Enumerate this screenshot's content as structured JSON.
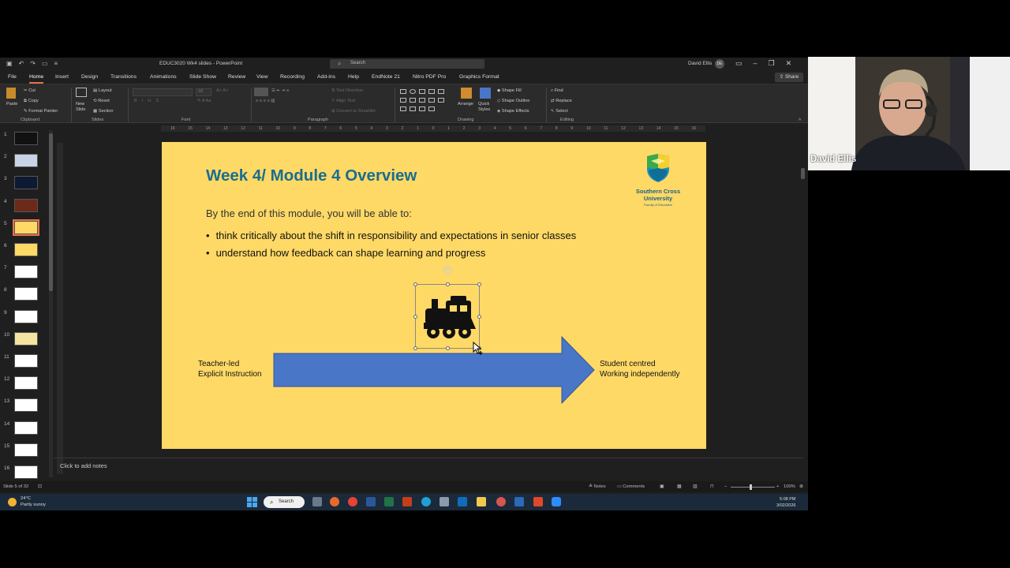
{
  "window": {
    "doc_title": "EDUC3020 Wk4 slides  -  PowerPoint",
    "search_placeholder": "Search",
    "user_name": "David Ellis",
    "user_initials": "DE"
  },
  "menu": {
    "tabs": [
      "File",
      "Home",
      "Insert",
      "Design",
      "Transitions",
      "Animations",
      "Slide Show",
      "Review",
      "View",
      "Recording",
      "Add-ins",
      "Help",
      "EndNote 21",
      "Nitro PDF Pro",
      "Graphics Format"
    ],
    "active_tab": "Home",
    "share_label": "Share"
  },
  "ribbon": {
    "clipboard": {
      "paste": "Paste",
      "cut": "Cut",
      "copy": "Copy",
      "format_painter": "Format Painter",
      "label": "Clipboard"
    },
    "slides": {
      "new_slide": "New Slide",
      "layout": "Layout",
      "reset": "Reset",
      "section": "Section",
      "label": "Slides"
    },
    "font": {
      "label": "Font",
      "font_size": "18"
    },
    "paragraph": {
      "text_direction": "Text Direction",
      "align_text": "Align Text",
      "convert_smartart": "Convert to SmartArt",
      "label": "Paragraph"
    },
    "drawing": {
      "arrange": "Arrange",
      "quick_styles": "Quick Styles",
      "shape_fill": "Shape Fill",
      "shape_outline": "Shape Outline",
      "shape_effects": "Shape Effects",
      "label": "Drawing"
    },
    "editing": {
      "find": "Find",
      "replace": "Replace",
      "select": "Select",
      "label": "Editing"
    }
  },
  "ruler": {
    "labels": [
      "16",
      "15",
      "14",
      "13",
      "12",
      "11",
      "10",
      "9",
      "8",
      "7",
      "6",
      "5",
      "4",
      "3",
      "2",
      "1",
      "0",
      "1",
      "2",
      "3",
      "4",
      "5",
      "6",
      "7",
      "8",
      "9",
      "10",
      "11",
      "12",
      "13",
      "14",
      "15",
      "16"
    ]
  },
  "thumbnails": [
    "1",
    "2",
    "3",
    "4",
    "5",
    "6",
    "7",
    "8",
    "9",
    "10",
    "11",
    "12",
    "13",
    "14",
    "15",
    "16"
  ],
  "slide": {
    "title": "Week 4/ Module 4 Overview",
    "intro": "By the end of this module, you will be able to:",
    "bullets": [
      "think critically about the shift in responsibility and expectations in senior classes",
      "understand how feedback can shape learning and progress"
    ],
    "logo": {
      "line1": "Southern Cross",
      "line2": "University",
      "faculty": "Faculty of Education"
    },
    "left_label": {
      "line1": "Teacher-led",
      "line2": "Explicit Instruction"
    },
    "right_label": {
      "line1": "Student centred",
      "line2": "Working independently"
    },
    "colors": {
      "background": "#ffd966",
      "title": "#1a6d8e",
      "arrow": "#4a76c8"
    }
  },
  "notes_placeholder": "Click to add notes",
  "status": {
    "slide_counter": "Slide 5 of 32",
    "notes": "Notes",
    "comments": "Comments",
    "zoom": "100%"
  },
  "taskbar": {
    "temperature": "24°C",
    "weather": "Partly sunny",
    "search": "Search",
    "time": "5:08 PM",
    "date": "3/02/2026"
  },
  "video": {
    "participant": "David Ellis"
  }
}
